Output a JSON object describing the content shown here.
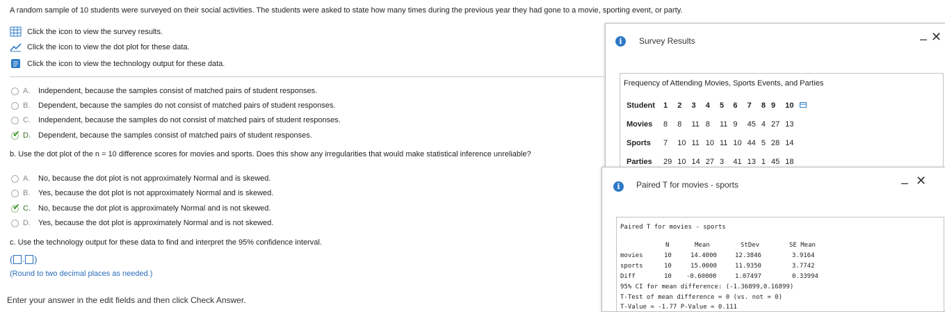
{
  "intro": "A random sample of 10 students were surveyed on their social activities. The students were asked to state how many times during the previous year they had gone to a movie, sporting event, or party.",
  "links": {
    "survey": "Click the icon to view the survey results.",
    "dot_plot": "Click the icon to view the dot plot for these data.",
    "tech_output": "Click the icon to view the technology output for these data."
  },
  "part_a_options": [
    {
      "letter": "A.",
      "text": "Independent, because the samples consist of matched pairs of student responses."
    },
    {
      "letter": "B.",
      "text": "Dependent, because the samples do not consist of matched pairs of student responses."
    },
    {
      "letter": "C.",
      "text": "Independent, because the samples do not consist of matched pairs of student responses."
    },
    {
      "letter": "D.",
      "text": "Dependent, because the samples consist of matched pairs of student responses."
    }
  ],
  "part_b": {
    "question": "b. Use the dot plot of the n = 10 difference scores for movies and sports. Does this show any irregularities that would make statistical inference unreliable?",
    "options": [
      {
        "letter": "A.",
        "text": "No, because the dot plot is not approximately Normal and is skewed."
      },
      {
        "letter": "B.",
        "text": "Yes, because the dot plot is not approximately Normal and is skewed."
      },
      {
        "letter": "C.",
        "text": "No, because the dot plot is approximately Normal and is not skewed."
      },
      {
        "letter": "D.",
        "text": "Yes, because the dot plot is approximately Normal and is not skewed."
      }
    ]
  },
  "part_c": {
    "question": "c. Use the technology output for these data to find and interpret the 95% confidence interval.",
    "open_paren": "(",
    "comma": ",",
    "close_paren": ")",
    "note": "(Round to two decimal places as needed.)"
  },
  "footer": "Enter your answer in the edit fields and then click Check Answer.",
  "survey_panel": {
    "title": "Survey Results",
    "minimize": "–",
    "close": "✕",
    "table_title": "Frequency of Attending Movies, Sports Events, and Parties",
    "rows": [
      {
        "label": "Student",
        "values": [
          "1",
          "2",
          "3",
          "4",
          "5",
          "6",
          "7",
          "8",
          "9",
          "10"
        ]
      },
      {
        "label": "Movies",
        "values": [
          "8",
          "8",
          "11",
          "8",
          "11",
          "9",
          "45",
          "4",
          "27",
          "13"
        ]
      },
      {
        "label": "Sports",
        "values": [
          "7",
          "10",
          "11",
          "10",
          "11",
          "10",
          "44",
          "5",
          "28",
          "14"
        ]
      },
      {
        "label": "Parties",
        "values": [
          "29",
          "10",
          "14",
          "27",
          "3",
          "41",
          "13",
          "1",
          "45",
          "18"
        ]
      }
    ]
  },
  "paired_panel": {
    "title": "Paired T for movies - sports",
    "minimize": "–",
    "close": "✕",
    "heading": "Paired T for movies - sports",
    "col_headers": [
      "N",
      "Mean",
      "StDev",
      "SE Mean"
    ],
    "rows": [
      {
        "label": "movies",
        "n": "10",
        "mean": "14.4000",
        "stdev": "12.3846",
        "se": "3.9164"
      },
      {
        "label": "sports",
        "n": "10",
        "mean": "15.0000",
        "stdev": "11.9350",
        "se": "3.7742"
      },
      {
        "label": "Diff",
        "n": "10",
        "mean": "-0.60000",
        "stdev": "1.07497",
        "se": "0.33994"
      }
    ],
    "ci_line": "95% CI for mean difference: (-1.36899,0.16899)",
    "ttest_line": "T-Test of mean difference = 0 (vs. not = 0)",
    "tvalue_line": "T-Value = -1.77 P-Value = 0.111"
  },
  "colors": {
    "link_blue": "#2a6ebb",
    "check_green": "#3d9a2d",
    "info_blue": "#2d79c7"
  }
}
